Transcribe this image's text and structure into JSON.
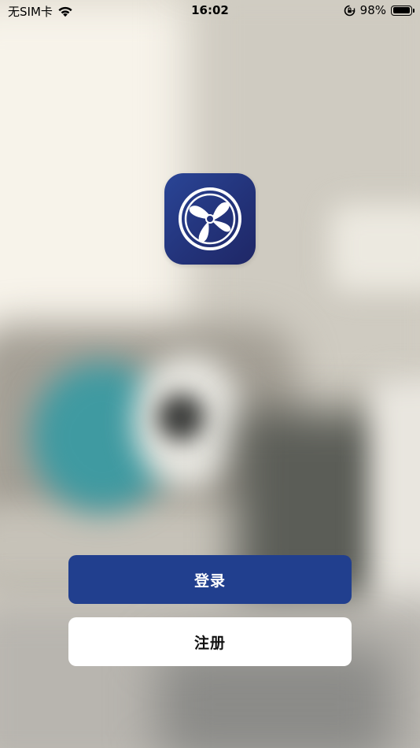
{
  "status_bar": {
    "carrier": "无SIM卡",
    "time": "16:02",
    "battery_percent": "98%",
    "battery_level": 0.98,
    "icons": [
      "wifi-icon",
      "rotation-lock-icon",
      "battery-icon"
    ]
  },
  "app": {
    "logo_icon": "fan-logo-icon",
    "brand_color": "#213f8e"
  },
  "actions": {
    "login_label": "登录",
    "register_label": "注册"
  },
  "colors": {
    "login_bg": "#213f8e",
    "login_text": "#ffffff",
    "register_bg": "#ffffff",
    "register_text": "#111111"
  }
}
